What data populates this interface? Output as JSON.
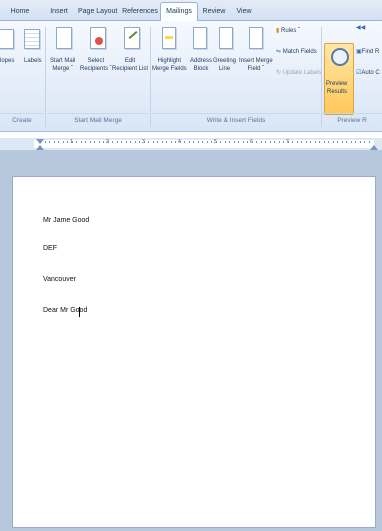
{
  "tabs": [
    {
      "id": "home",
      "label": "Home"
    },
    {
      "id": "insert",
      "label": "Insert"
    },
    {
      "id": "page_layout",
      "label": "Page Layout"
    },
    {
      "id": "references",
      "label": "References"
    },
    {
      "id": "mailings",
      "label": "Mailings",
      "active": true
    },
    {
      "id": "review",
      "label": "Review"
    },
    {
      "id": "view",
      "label": "View"
    }
  ],
  "ribbon": {
    "create": {
      "envelopes_label": "lopes",
      "labels_label": "Labels",
      "group_label": "Create"
    },
    "start_mail_merge": {
      "start_line1": "Start Mail",
      "start_line2": "Merge ˇ",
      "select_line1": "Select",
      "select_line2": "Recipients ˇ",
      "edit_line1": "Edit",
      "edit_line2": "Recipient List",
      "group_label": "Start Mail Merge"
    },
    "write_insert": {
      "highlight_line1": "Highlight",
      "highlight_line2": "Merge Fields",
      "address_line1": "Address",
      "address_line2": "Block",
      "greeting_line1": "Greeting",
      "greeting_line2": "Line",
      "insert_line1": "Insert Merge",
      "insert_line2": "Field ˇ",
      "rules_label": "Rules ˇ",
      "match_label": "Match Fields",
      "update_label": "Update Labels",
      "group_label": "Write & Insert Fields"
    },
    "preview": {
      "preview_line1": "Preview",
      "preview_line2": "Results",
      "find_label": "Find R",
      "auto_label": "Auto C",
      "group_label": "Preview R"
    }
  },
  "ruler": {
    "numbers": [
      "1",
      "2",
      "3",
      "4",
      "5",
      "6",
      "7"
    ]
  },
  "document": {
    "lines": [
      "Mr Jame Good",
      "DEF",
      "Vancouver",
      "Dear Mr Good"
    ]
  },
  "colors": {
    "accent": "#1e395b",
    "ribbon_bg": "#dce8f7",
    "preview_active": "#ffc85a",
    "canvas": "#b7c7dc"
  }
}
